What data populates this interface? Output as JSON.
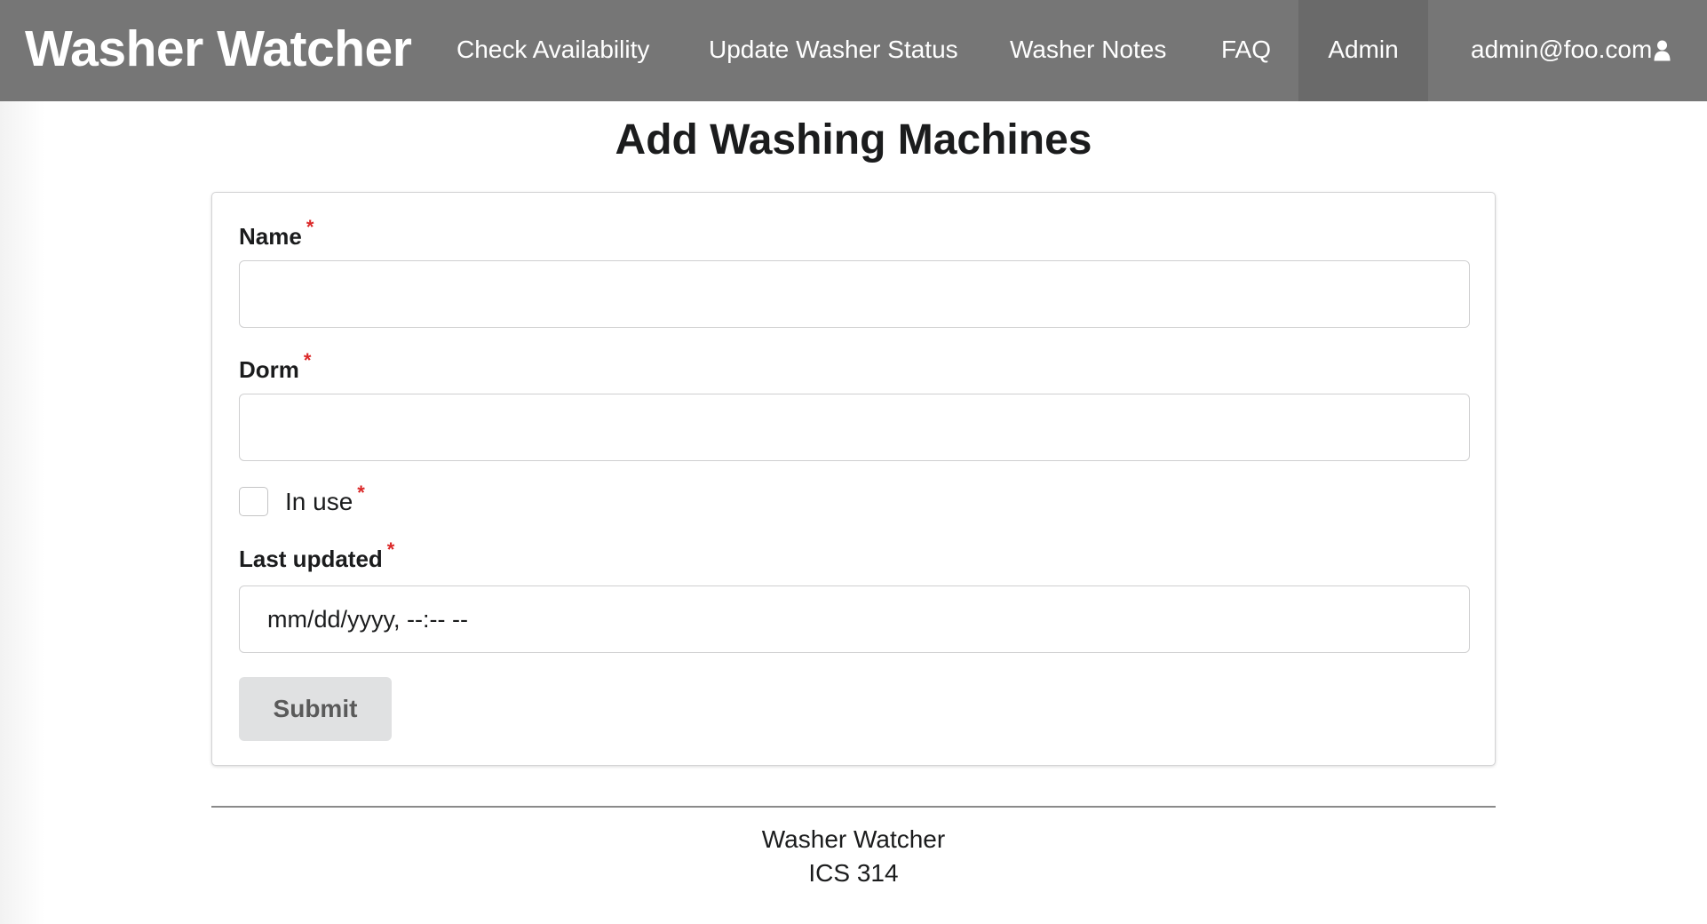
{
  "navbar": {
    "brand": "Washer Watcher",
    "items": [
      {
        "label": "Check Availability",
        "active": false
      },
      {
        "label": "Update Washer Status",
        "active": false
      },
      {
        "label": "Washer Notes",
        "active": false
      },
      {
        "label": "FAQ",
        "active": false
      },
      {
        "label": "Admin",
        "active": true
      }
    ],
    "user": {
      "email": "admin@foo.com",
      "icon": "user-icon"
    },
    "background": "#767676",
    "active_background": "#6a6a6a"
  },
  "page": {
    "title": "Add Washing Machines"
  },
  "form": {
    "name": {
      "label": "Name",
      "required_mark": "*",
      "value": ""
    },
    "dorm": {
      "label": "Dorm",
      "required_mark": "*",
      "value": ""
    },
    "in_use": {
      "label": "In use",
      "required_mark": "*",
      "checked": false
    },
    "last_updated": {
      "label": "Last updated",
      "required_mark": "*",
      "placeholder": "mm/dd/yyyy, --:-- --"
    },
    "submit_label": "Submit",
    "required_color": "#db2828"
  },
  "footer": {
    "line1": "Washer Watcher",
    "line2": "ICS 314"
  }
}
